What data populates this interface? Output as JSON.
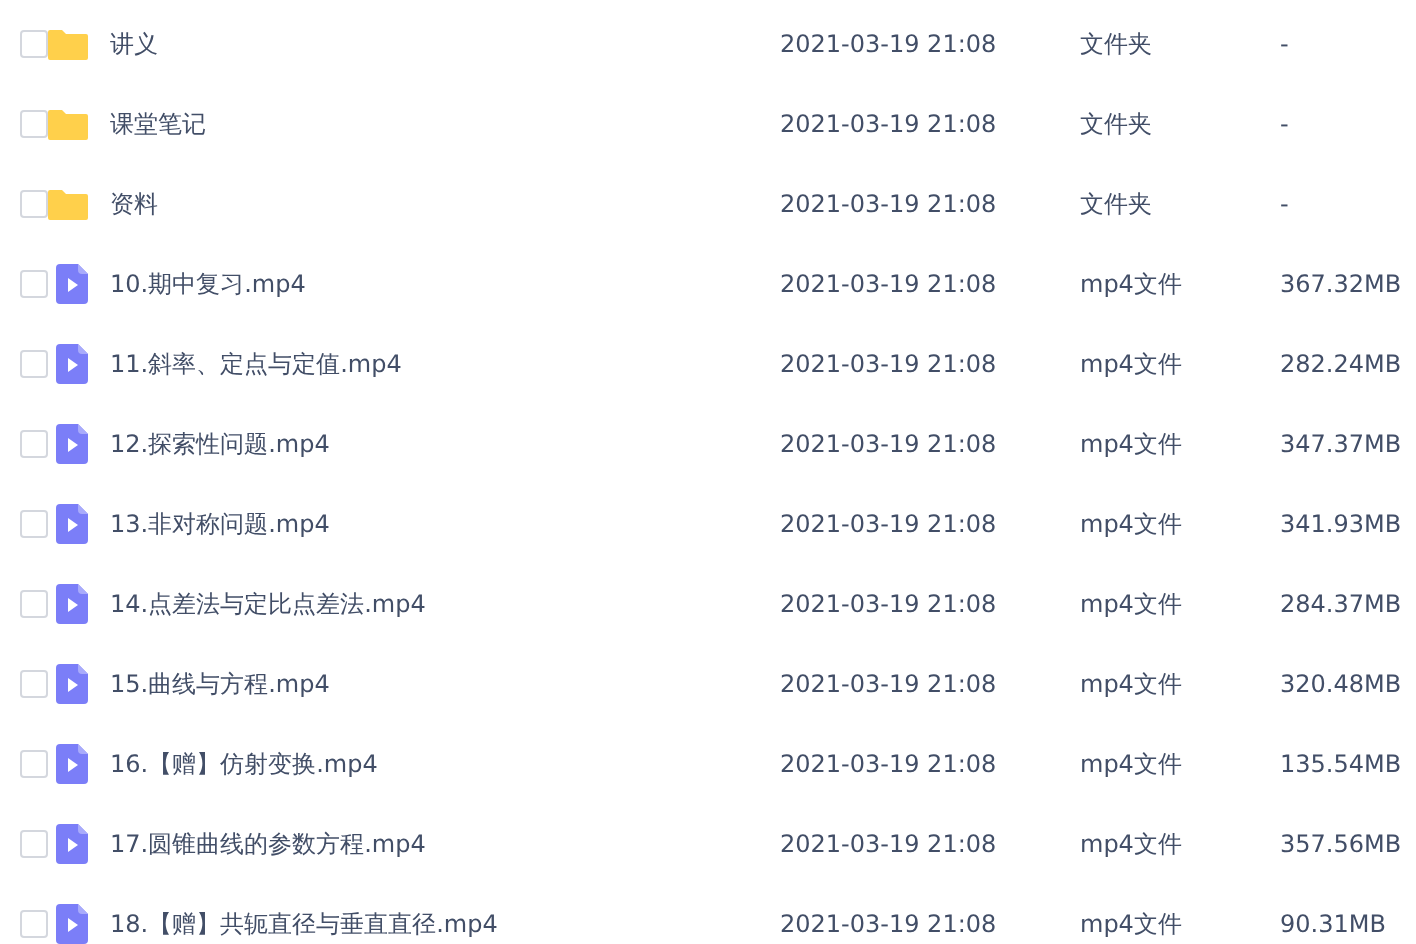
{
  "files": [
    {
      "kind": "folder",
      "name": "讲义",
      "modified": "2021-03-19 21:08",
      "type": "文件夹",
      "size": "-",
      "checked": false
    },
    {
      "kind": "folder",
      "name": "课堂笔记",
      "modified": "2021-03-19 21:08",
      "type": "文件夹",
      "size": "-",
      "checked": false
    },
    {
      "kind": "folder",
      "name": "资料",
      "modified": "2021-03-19 21:08",
      "type": "文件夹",
      "size": "-",
      "checked": false
    },
    {
      "kind": "video",
      "name": "10.期中复习.mp4",
      "modified": "2021-03-19 21:08",
      "type": "mp4文件",
      "size": "367.32MB",
      "checked": false
    },
    {
      "kind": "video",
      "name": "11.斜率、定点与定值.mp4",
      "modified": "2021-03-19 21:08",
      "type": "mp4文件",
      "size": "282.24MB",
      "checked": false
    },
    {
      "kind": "video",
      "name": "12.探索性问题.mp4",
      "modified": "2021-03-19 21:08",
      "type": "mp4文件",
      "size": "347.37MB",
      "checked": false
    },
    {
      "kind": "video",
      "name": "13.非对称问题.mp4",
      "modified": "2021-03-19 21:08",
      "type": "mp4文件",
      "size": "341.93MB",
      "checked": false
    },
    {
      "kind": "video",
      "name": "14.点差法与定比点差法.mp4",
      "modified": "2021-03-19 21:08",
      "type": "mp4文件",
      "size": "284.37MB",
      "checked": false
    },
    {
      "kind": "video",
      "name": "15.曲线与方程.mp4",
      "modified": "2021-03-19 21:08",
      "type": "mp4文件",
      "size": "320.48MB",
      "checked": false
    },
    {
      "kind": "video",
      "name": "16.【赠】仿射变换.mp4",
      "modified": "2021-03-19 21:08",
      "type": "mp4文件",
      "size": "135.54MB",
      "checked": false
    },
    {
      "kind": "video",
      "name": "17.圆锥曲线的参数方程.mp4",
      "modified": "2021-03-19 21:08",
      "type": "mp4文件",
      "size": "357.56MB",
      "checked": false
    },
    {
      "kind": "video",
      "name": "18.【赠】共轭直径与垂直直径.mp4",
      "modified": "2021-03-19 21:08",
      "type": "mp4文件",
      "size": "90.31MB",
      "checked": false
    }
  ]
}
